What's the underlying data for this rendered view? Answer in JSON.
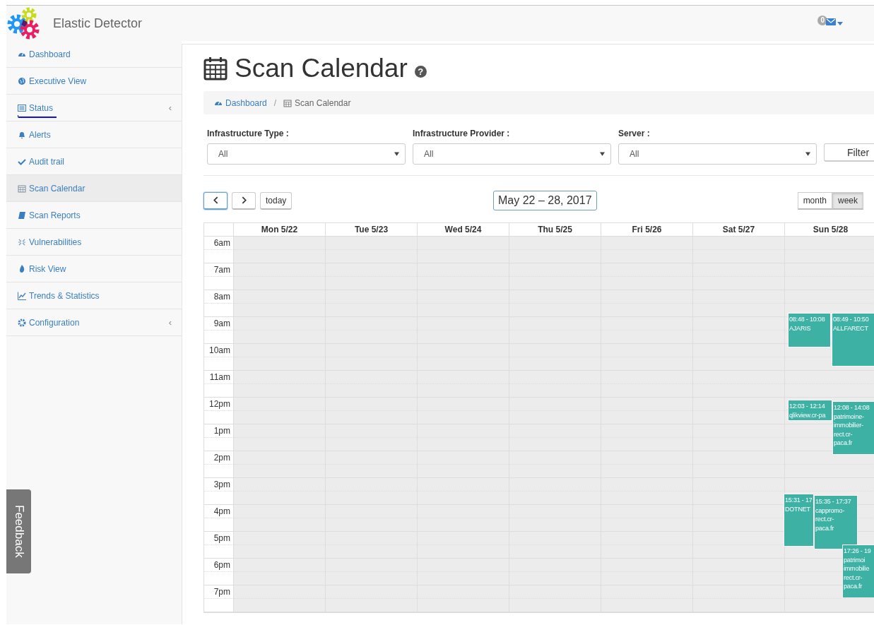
{
  "app": {
    "title": "Elastic Detector"
  },
  "notifications": {
    "count": "0"
  },
  "sidebar": {
    "items": [
      {
        "label": "Dashboard",
        "selected": false,
        "underlined": false
      },
      {
        "label": "Executive View",
        "selected": false,
        "underlined": false
      },
      {
        "label": "Status",
        "selected": false,
        "underlined": true,
        "arrow": "‹"
      },
      {
        "label": "Alerts",
        "selected": false,
        "underlined": false
      },
      {
        "label": "Audit trail",
        "selected": false,
        "underlined": false
      },
      {
        "label": "Scan Calendar",
        "selected": true,
        "underlined": false
      },
      {
        "label": "Scan Reports",
        "selected": false,
        "underlined": false
      },
      {
        "label": "Vulnerabilities",
        "selected": false,
        "underlined": false
      },
      {
        "label": "Risk View",
        "selected": false,
        "underlined": false
      },
      {
        "label": "Trends & Statistics",
        "selected": false,
        "underlined": false
      },
      {
        "label": "Configuration",
        "selected": false,
        "underlined": false,
        "arrow": "‹"
      }
    ]
  },
  "feedback": {
    "label": "Feedback"
  },
  "page": {
    "title": "Scan Calendar",
    "help": "?"
  },
  "breadcrumb": {
    "items": [
      "Dashboard",
      "Scan Calendar"
    ],
    "separator": "/"
  },
  "filters": [
    {
      "label": "Infrastructure Type :",
      "value": "All"
    },
    {
      "label": "Infrastructure Provider :",
      "value": "All"
    },
    {
      "label": "Server :",
      "value": "All"
    }
  ],
  "filter_button": "Filter",
  "toolbar": {
    "nav": [
      {
        "kind": "prev",
        "focused": true
      },
      {
        "kind": "next",
        "focused": false
      }
    ],
    "today": "today",
    "range": "May 22 – 28, 2017",
    "views": [
      {
        "label": "month",
        "selected": false
      },
      {
        "label": "week",
        "selected": true
      }
    ]
  },
  "calendar": {
    "time_slots": [
      "6am",
      "7am",
      "8am",
      "9am",
      "10am",
      "11am",
      "12pm",
      "1pm",
      "2pm",
      "3pm",
      "4pm",
      "5pm",
      "6pm",
      "7pm"
    ],
    "days": [
      {
        "label": "Mon 5/22"
      },
      {
        "label": "Tue 5/23"
      },
      {
        "label": "Wed 5/24"
      },
      {
        "label": "Thu 5/25"
      },
      {
        "label": "Fri 5/26"
      },
      {
        "label": "Sat 5/27"
      },
      {
        "label": "Sun 5/28",
        "events": [
          {
            "time": "08:48 - 10:08",
            "title_lines": [
              "AJARIS"
            ]
          },
          {
            "time": "08:49 - 10:50",
            "title_lines": [
              "ALLFARECT"
            ]
          },
          {
            "time": "12:03 - 12:14",
            "title_lines": [
              "qlikview.cr-pa"
            ]
          },
          {
            "time": "12:08 - 14:08",
            "title_lines": [
              "patrimoine-",
              "immobilier-",
              "rect.cr-",
              "paca.fr"
            ]
          },
          {
            "time": "15:31 - 17",
            "title_lines": [
              "DOTNET"
            ]
          },
          {
            "time": "15:35 - 17:37",
            "title_lines": [
              "cappromo-",
              "rect.cr-",
              "paca.fr"
            ]
          },
          {
            "time": "17:26 - 19",
            "title_lines": [
              "patrimoi",
              "immobilie",
              "rect.cr-",
              "paca.fr"
            ]
          }
        ]
      }
    ]
  }
}
